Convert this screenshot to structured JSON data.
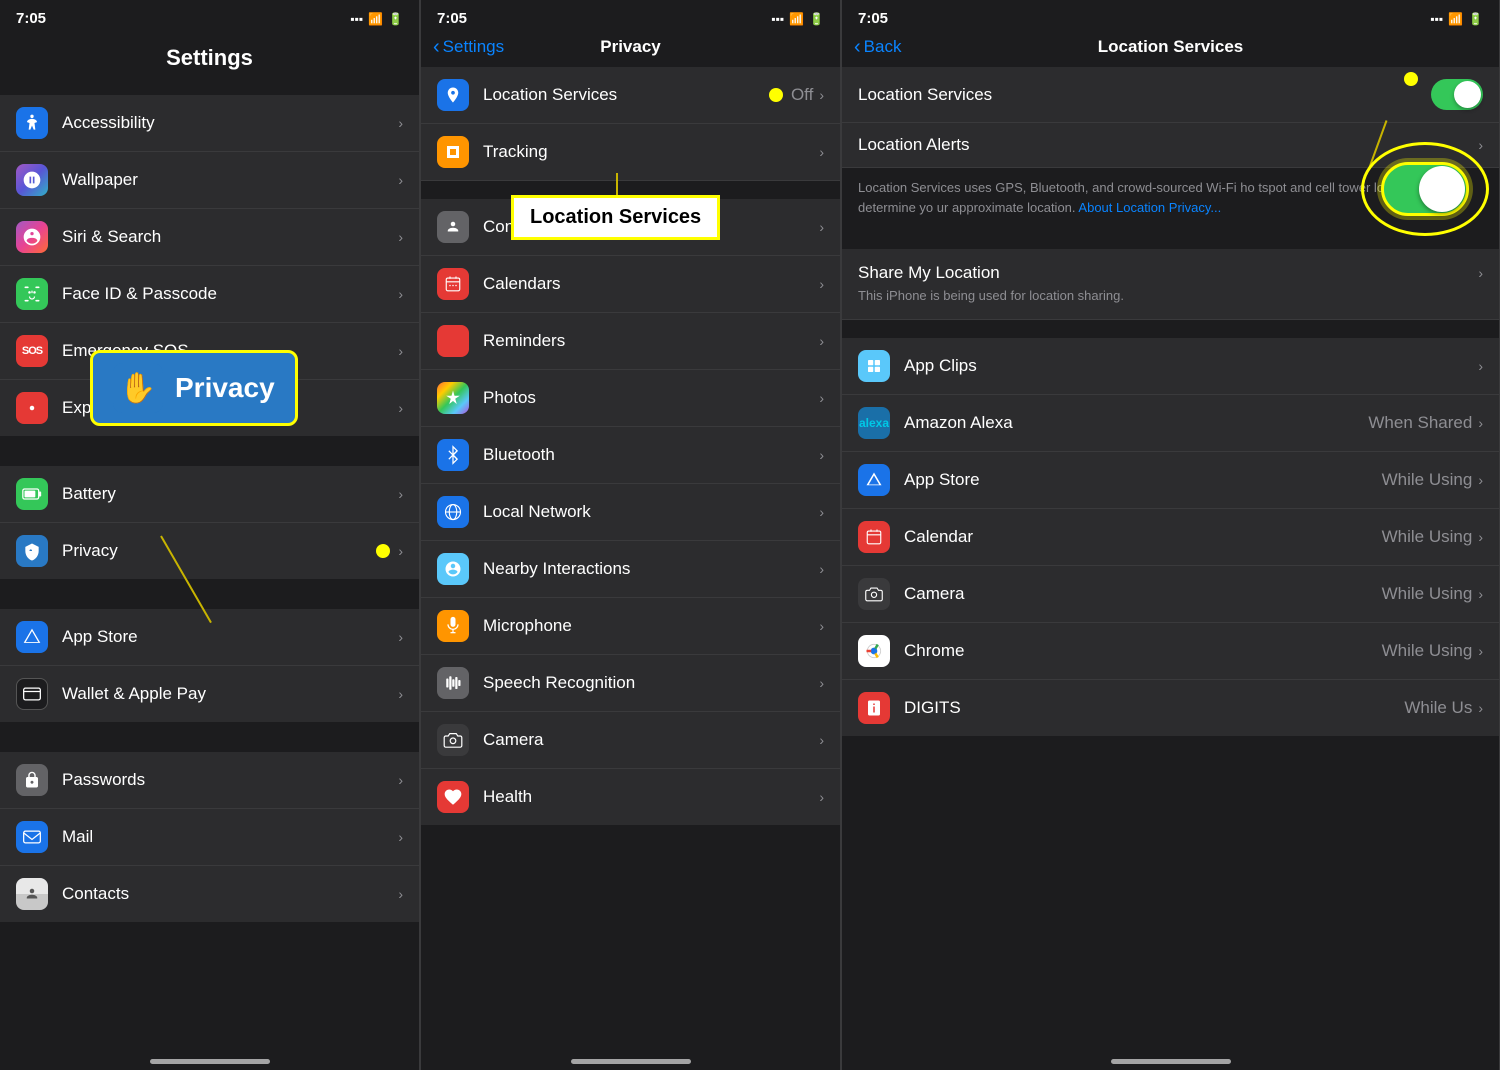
{
  "panels": {
    "panel1": {
      "statusBar": {
        "time": "7:05",
        "location": "◀"
      },
      "title": "Settings",
      "items": [
        {
          "id": "accessibility",
          "icon": "♿",
          "iconBg": "icon-blue",
          "label": "Accessibility"
        },
        {
          "id": "wallpaper",
          "icon": "❄",
          "iconBg": "icon-gradient-siri",
          "label": "Wallpaper"
        },
        {
          "id": "siri",
          "icon": "🔮",
          "iconBg": "icon-gradient-siri",
          "label": "Siri & Search"
        },
        {
          "id": "faceid",
          "icon": "🔲",
          "iconBg": "icon-green",
          "label": "Face ID & Passcode"
        },
        {
          "id": "emergency",
          "icon": "SOS",
          "iconBg": "icon-red",
          "label": "Emergency SOS"
        },
        {
          "id": "exposure",
          "icon": "🔔",
          "iconBg": "icon-red",
          "label": "Exposure Notifications"
        },
        {
          "id": "battery",
          "icon": "🔋",
          "iconBg": "icon-green",
          "label": "Battery"
        },
        {
          "id": "privacy",
          "icon": "✋",
          "iconBg": "icon-mid-blue",
          "label": "Privacy"
        },
        {
          "id": "appstore",
          "icon": "A",
          "iconBg": "icon-blue",
          "label": "App Store"
        },
        {
          "id": "wallet",
          "icon": "💳",
          "iconBg": "icon-dark-gray",
          "label": "Wallet & Apple Pay"
        },
        {
          "id": "passwords",
          "icon": "🔑",
          "iconBg": "icon-gray",
          "label": "Passwords"
        },
        {
          "id": "mail",
          "icon": "✉",
          "iconBg": "icon-blue",
          "label": "Mail"
        },
        {
          "id": "contacts",
          "icon": "👤",
          "iconBg": "icon-teal",
          "label": "Contacts"
        }
      ]
    },
    "panel2": {
      "statusBar": {
        "time": "7:05"
      },
      "backLabel": "Settings",
      "title": "Privacy",
      "items": [
        {
          "id": "location",
          "icon": "📍",
          "iconBg": "icon-location",
          "label": "Location Services",
          "value": "Off"
        },
        {
          "id": "tracking",
          "icon": "🔀",
          "iconBg": "icon-tracking",
          "label": "Tracking"
        },
        {
          "id": "contacts",
          "icon": "👤",
          "iconBg": "icon-gray",
          "label": "Contacts"
        },
        {
          "id": "calendars",
          "icon": "📅",
          "iconBg": "icon-red",
          "label": "Calendars"
        },
        {
          "id": "reminders",
          "icon": "📋",
          "iconBg": "icon-red",
          "label": "Reminders"
        },
        {
          "id": "photos",
          "icon": "🌸",
          "iconBg": "icon-purple",
          "label": "Photos"
        },
        {
          "id": "bluetooth",
          "icon": "✱",
          "iconBg": "icon-blue",
          "label": "Bluetooth"
        },
        {
          "id": "localnetwork",
          "icon": "🌐",
          "iconBg": "icon-blue",
          "label": "Local Network"
        },
        {
          "id": "nearby",
          "icon": "📡",
          "iconBg": "icon-teal",
          "label": "Nearby Interactions"
        },
        {
          "id": "microphone",
          "icon": "🎙",
          "iconBg": "icon-orange",
          "label": "Microphone"
        },
        {
          "id": "speech",
          "icon": "🔊",
          "iconBg": "icon-gray",
          "label": "Speech Recognition"
        },
        {
          "id": "camera",
          "icon": "📷",
          "iconBg": "icon-dark-gray",
          "label": "Camera"
        },
        {
          "id": "health",
          "icon": "❤",
          "iconBg": "icon-red",
          "label": "Health"
        }
      ],
      "locationPopupLabel": "Location Services"
    },
    "panel3": {
      "statusBar": {
        "time": "7:05"
      },
      "backLabel": "Back",
      "title": "Location Services",
      "toggleOn": true,
      "toggleLabel": "Location Services",
      "locationAlertsLabel": "Location Alerts",
      "description": "Location Services uses GPS, Bluetooth, and crowd-sourced Wi-Fi hotspot and cell tower locations to determine your approximate location.",
      "descriptionLink": "About Location Privacy...",
      "shareMyLocationLabel": "Share My Location",
      "shareMyLocationDesc": "This iPhone is being used for location sharing.",
      "appItems": [
        {
          "id": "appclips",
          "icon": "🎫",
          "iconBg": "icon-teal",
          "label": "App Clips",
          "value": ""
        },
        {
          "id": "alexa",
          "icon": "alexa",
          "iconBg": "icon-blue",
          "label": "Amazon Alexa",
          "value": "When Shared"
        },
        {
          "id": "appstore2",
          "icon": "A",
          "iconBg": "icon-blue",
          "label": "App Store",
          "value": "While Using"
        },
        {
          "id": "calendar",
          "icon": "📅",
          "iconBg": "icon-red",
          "label": "Calendar",
          "value": "While Using"
        },
        {
          "id": "camera",
          "icon": "📷",
          "iconBg": "icon-dark-gray",
          "label": "Camera",
          "value": "While Using"
        },
        {
          "id": "chrome",
          "icon": "🌐",
          "iconBg": "icon-blue",
          "label": "Chrome",
          "value": "While Using"
        },
        {
          "id": "digits",
          "icon": "📞",
          "iconBg": "icon-red",
          "label": "DIGITS",
          "value": "While Using"
        }
      ]
    }
  },
  "annotations": {
    "privacyBoxLabel": "Privacy",
    "locationServicesPopup": "Location Services"
  },
  "icons": {
    "chevron": "›",
    "backChevron": "‹"
  }
}
